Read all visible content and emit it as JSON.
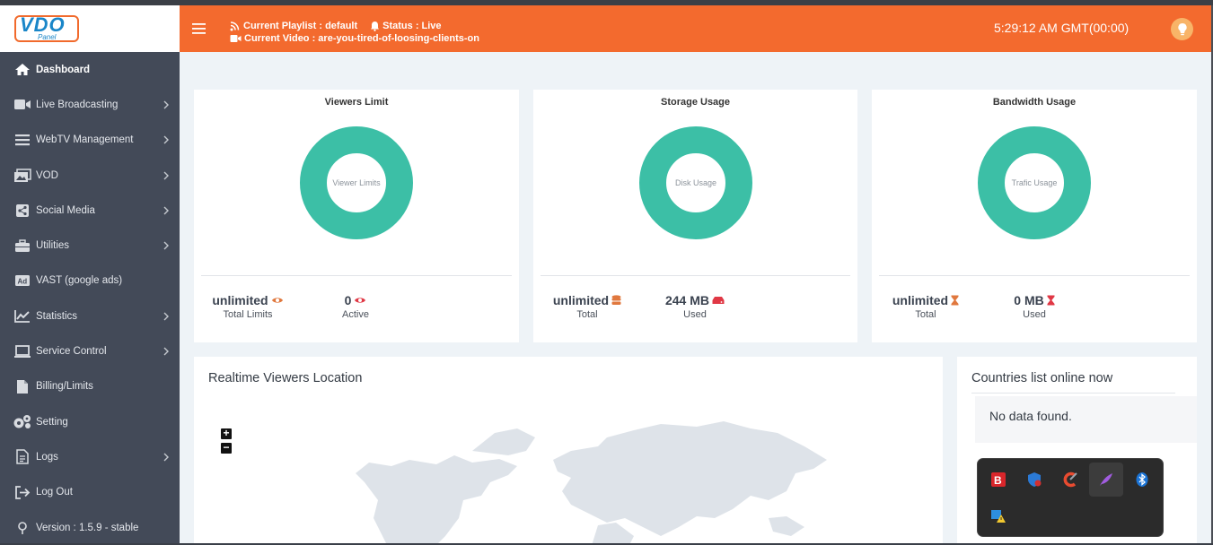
{
  "sidebar": {
    "logo_text": "VDO",
    "logo_sub": "Panel",
    "items": [
      {
        "label": "Dashboard"
      },
      {
        "label": "Live Broadcasting"
      },
      {
        "label": "WebTV Management"
      },
      {
        "label": "VOD"
      },
      {
        "label": "Social Media"
      },
      {
        "label": "Utilities"
      },
      {
        "label": "VAST (google ads)"
      },
      {
        "label": "Statistics"
      },
      {
        "label": "Service Control"
      },
      {
        "label": "Billing/Limits"
      },
      {
        "label": "Setting"
      },
      {
        "label": "Logs"
      },
      {
        "label": "Log Out"
      },
      {
        "label": "Version : 1.5.9 - stable"
      }
    ]
  },
  "header": {
    "playlist": "Current Playlist : default",
    "status": "Status : Live",
    "video": "Current Video : are-you-tired-of-loosing-clients-on",
    "clock": "5:29:12 AM GMT(00:00)"
  },
  "cards": [
    {
      "title": "Viewers Limit",
      "center": "Viewer Limits",
      "left_val": "unlimited",
      "left_lbl": "Total Limits",
      "right_val": "0",
      "right_lbl": "Active",
      "left_icon": "eye-icon",
      "right_icon": "eye-icon"
    },
    {
      "title": "Storage Usage",
      "center": "Disk Usage",
      "left_val": "unlimited",
      "left_lbl": "Total",
      "right_val": "244 MB",
      "right_lbl": "Used",
      "left_icon": "database-icon",
      "right_icon": "hdd-icon"
    },
    {
      "title": "Bandwidth Usage",
      "center": "Trafic Usage",
      "left_val": "unlimited",
      "left_lbl": "Total",
      "right_val": "0 MB",
      "right_lbl": "Used",
      "left_icon": "hourglass-icon",
      "right_icon": "hourglass-icon"
    }
  ],
  "map": {
    "title": "Realtime Viewers Location",
    "zoom_in": "+",
    "zoom_out": "−"
  },
  "countries": {
    "title": "Countries list online now",
    "empty": "No data found."
  },
  "colors": {
    "orange": "#f36a2e",
    "sidebar": "#434a58",
    "teal": "#3cbfa6",
    "content_bg": "#eef3f7"
  }
}
